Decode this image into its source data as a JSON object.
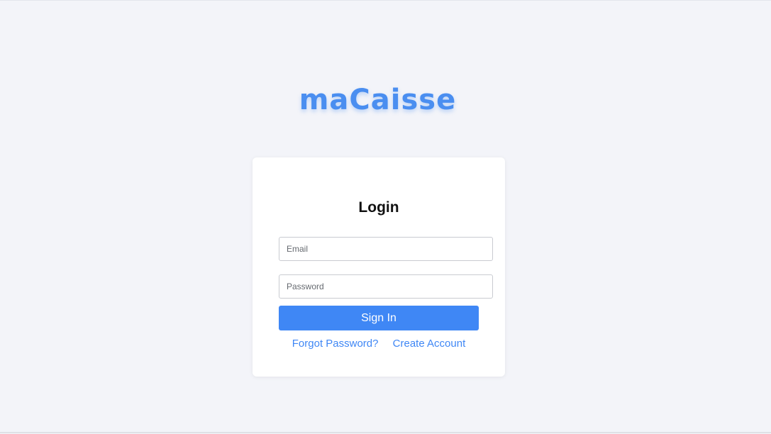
{
  "app": {
    "brand": "maCaisse"
  },
  "login": {
    "title": "Login",
    "email_placeholder": "Email",
    "email_value": "",
    "password_placeholder": "Password",
    "password_value": "",
    "signin_label": "Sign In",
    "forgot_password_label": "Forgot Password?",
    "create_account_label": "Create Account"
  },
  "colors": {
    "accent": "#3f87f5",
    "background": "#f3f4f9",
    "card": "#ffffff"
  }
}
